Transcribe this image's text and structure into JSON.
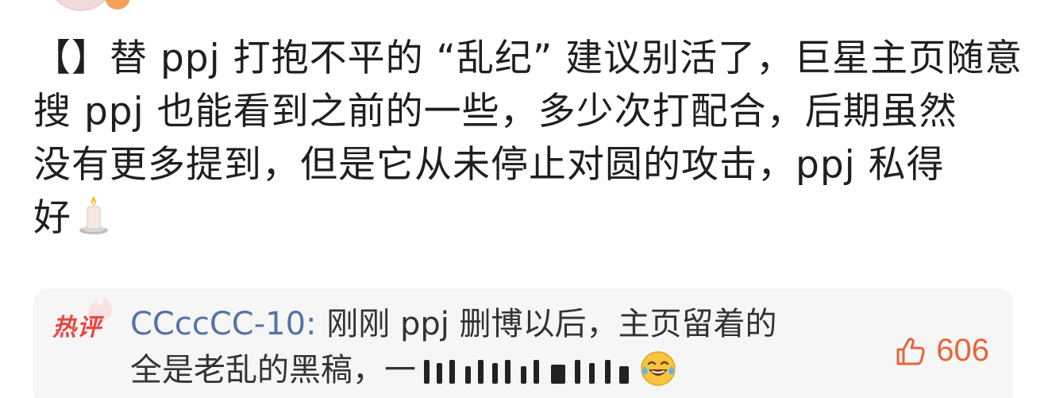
{
  "post": {
    "lines": [
      "【】替 ppj 打抱不平的 “乱纪” 建议别活了，巨星主页随意",
      "搜 ppj 也能看到之前的一些，多少次打配合，后期虽然",
      "没有更多提到，但是它从未停止对圆的攻击，ppj 私得",
      "好"
    ],
    "trailing_emoji": "candle-icon"
  },
  "hot_comment": {
    "label": "热评",
    "author": "CCccCC-10:",
    "text_line1": " 刚刚 ppj 删博以后，主页留着的",
    "text_line2": "全是老乱的黑稿，一",
    "trailing_emoji": "laugh-cry-icon",
    "like_count": "606"
  },
  "colors": {
    "text": "#1f1f1f",
    "author": "#5474a6",
    "hot_label": "#e8473e",
    "like": "#e8643a",
    "comment_bg": "#f6f6f6"
  }
}
